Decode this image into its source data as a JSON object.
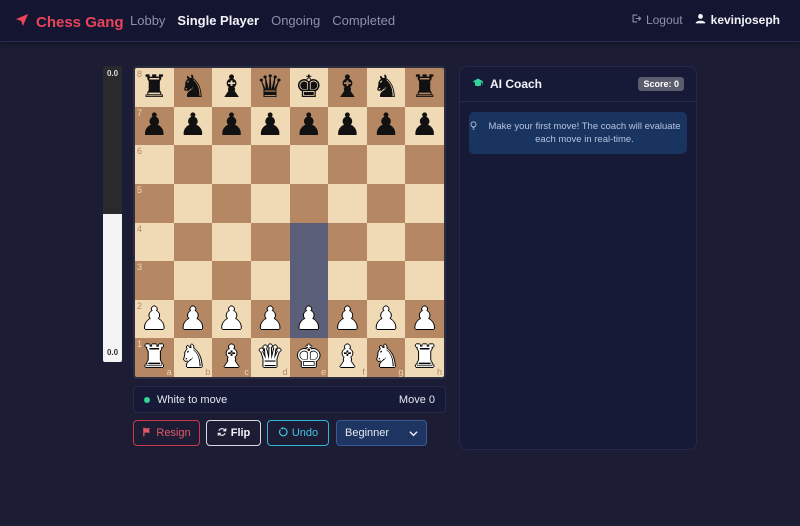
{
  "nav": {
    "brand": "Chess Gang",
    "links": [
      {
        "label": "Lobby",
        "active": false
      },
      {
        "label": "Single Player",
        "active": true
      },
      {
        "label": "Ongoing",
        "active": false
      },
      {
        "label": "Completed",
        "active": false
      }
    ],
    "logout": "Logout",
    "username": "kevinjoseph"
  },
  "eval": {
    "top_label": "0.0",
    "bottom_label": "0.0",
    "white_fraction": 0.5
  },
  "board": {
    "ranks": [
      [
        "br",
        "bn",
        "bb",
        "bq",
        "bk",
        "bb",
        "bn",
        "br"
      ],
      [
        "bp",
        "bp",
        "bp",
        "bp",
        "bp",
        "bp",
        "bp",
        "bp"
      ],
      [
        "",
        "",
        "",
        "",
        "",
        "",
        "",
        ""
      ],
      [
        "",
        "",
        "",
        "",
        "",
        "",
        "",
        ""
      ],
      [
        "",
        "",
        "",
        "",
        "",
        "",
        "",
        ""
      ],
      [
        "",
        "",
        "",
        "",
        "",
        "",
        "",
        ""
      ],
      [
        "wp",
        "wp",
        "wp",
        "wp",
        "wp",
        "wp",
        "wp",
        "wp"
      ],
      [
        "wr",
        "wn",
        "wb",
        "wq",
        "wk",
        "wb",
        "wn",
        "wr"
      ]
    ],
    "rank_labels": [
      "8",
      "7",
      "6",
      "5",
      "4",
      "3",
      "2",
      "1"
    ],
    "file_labels": [
      "a",
      "b",
      "c",
      "d",
      "e",
      "f",
      "g",
      "h"
    ],
    "highlighted": [
      "e2",
      "e3",
      "e4"
    ]
  },
  "status": {
    "turn": "White to move",
    "move": "Move 0"
  },
  "controls": {
    "resign": "Resign",
    "flip": "Flip",
    "undo": "Undo",
    "difficulty": "Beginner"
  },
  "coach": {
    "title": "AI Coach",
    "score": "Score: 0",
    "tip": "Make your first move! The coach will evaluate each move in real-time."
  },
  "colors": {
    "brand": "#e8445a",
    "light_square": "#f0d9b5",
    "dark_square": "#b58863",
    "highlight": "#5b5e78"
  }
}
